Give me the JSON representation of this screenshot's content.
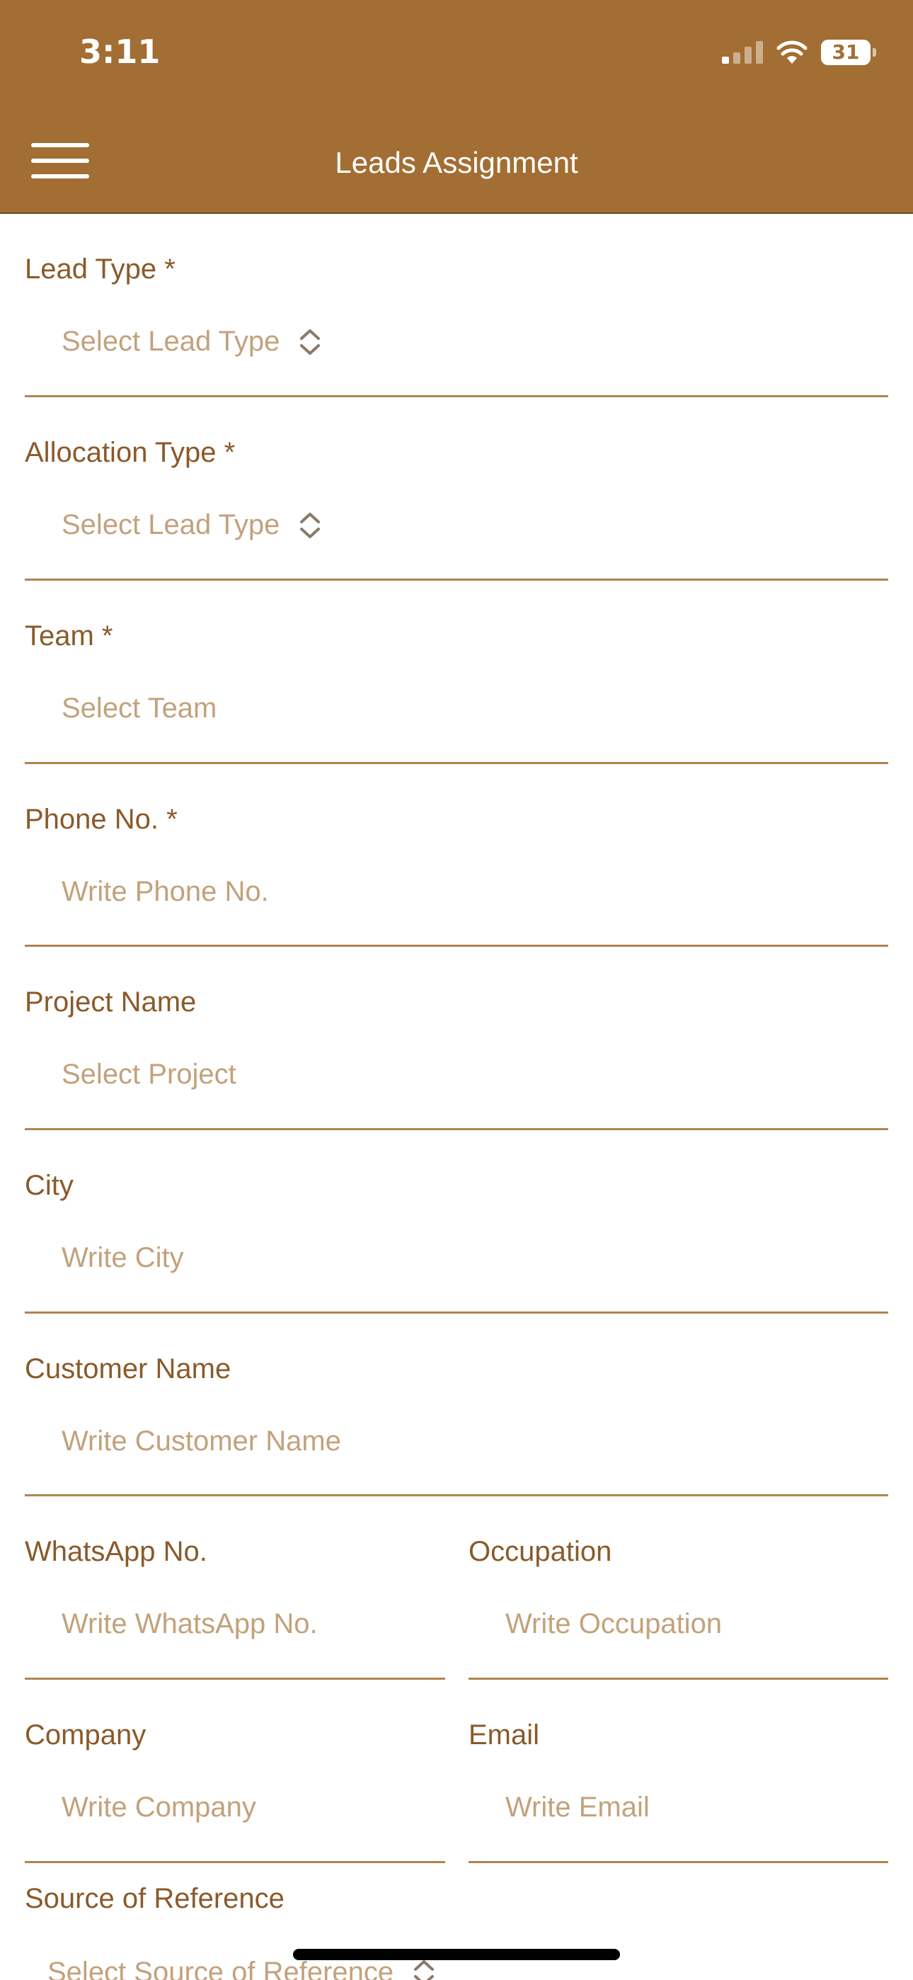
{
  "status_bar": {
    "time": "3:11",
    "battery": "31",
    "icons": [
      "signal-icon",
      "wifi-icon",
      "battery-icon"
    ]
  },
  "header": {
    "title": "Leads Assignment",
    "menu_icon": "hamburger-menu-icon"
  },
  "form": {
    "lead_type": {
      "label": "Lead Type *",
      "placeholder": "Select Lead Type",
      "icon": "chevron-up-down-icon"
    },
    "allocation_type": {
      "label": "Allocation Type *",
      "placeholder": "Select Lead Type",
      "icon": "chevron-up-down-icon"
    },
    "team": {
      "label": "Team *",
      "placeholder": "Select Team"
    },
    "phone": {
      "label": "Phone No. *",
      "placeholder": "Write Phone No."
    },
    "project_name": {
      "label": "Project Name",
      "placeholder": "Select Project"
    },
    "city": {
      "label": "City",
      "placeholder": "Write City"
    },
    "customer_name": {
      "label": "Customer Name",
      "placeholder": "Write Customer Name"
    },
    "whatsapp": {
      "label": "WhatsApp No.",
      "placeholder": "Write WhatsApp No."
    },
    "occupation": {
      "label": "Occupation",
      "placeholder": "Write Occupation"
    },
    "company": {
      "label": "Company",
      "placeholder": "Write Company"
    },
    "email": {
      "label": "Email",
      "placeholder": "Write Email"
    },
    "source_of_reference": {
      "label": "Source of Reference",
      "placeholder": "Select Source of Reference",
      "icon": "chevron-up-down-icon"
    }
  },
  "colors": {
    "header_bg": "#A26E33",
    "label": "#8A5A2A",
    "placeholder": "#C2A27C",
    "divider": "#B1844E"
  }
}
